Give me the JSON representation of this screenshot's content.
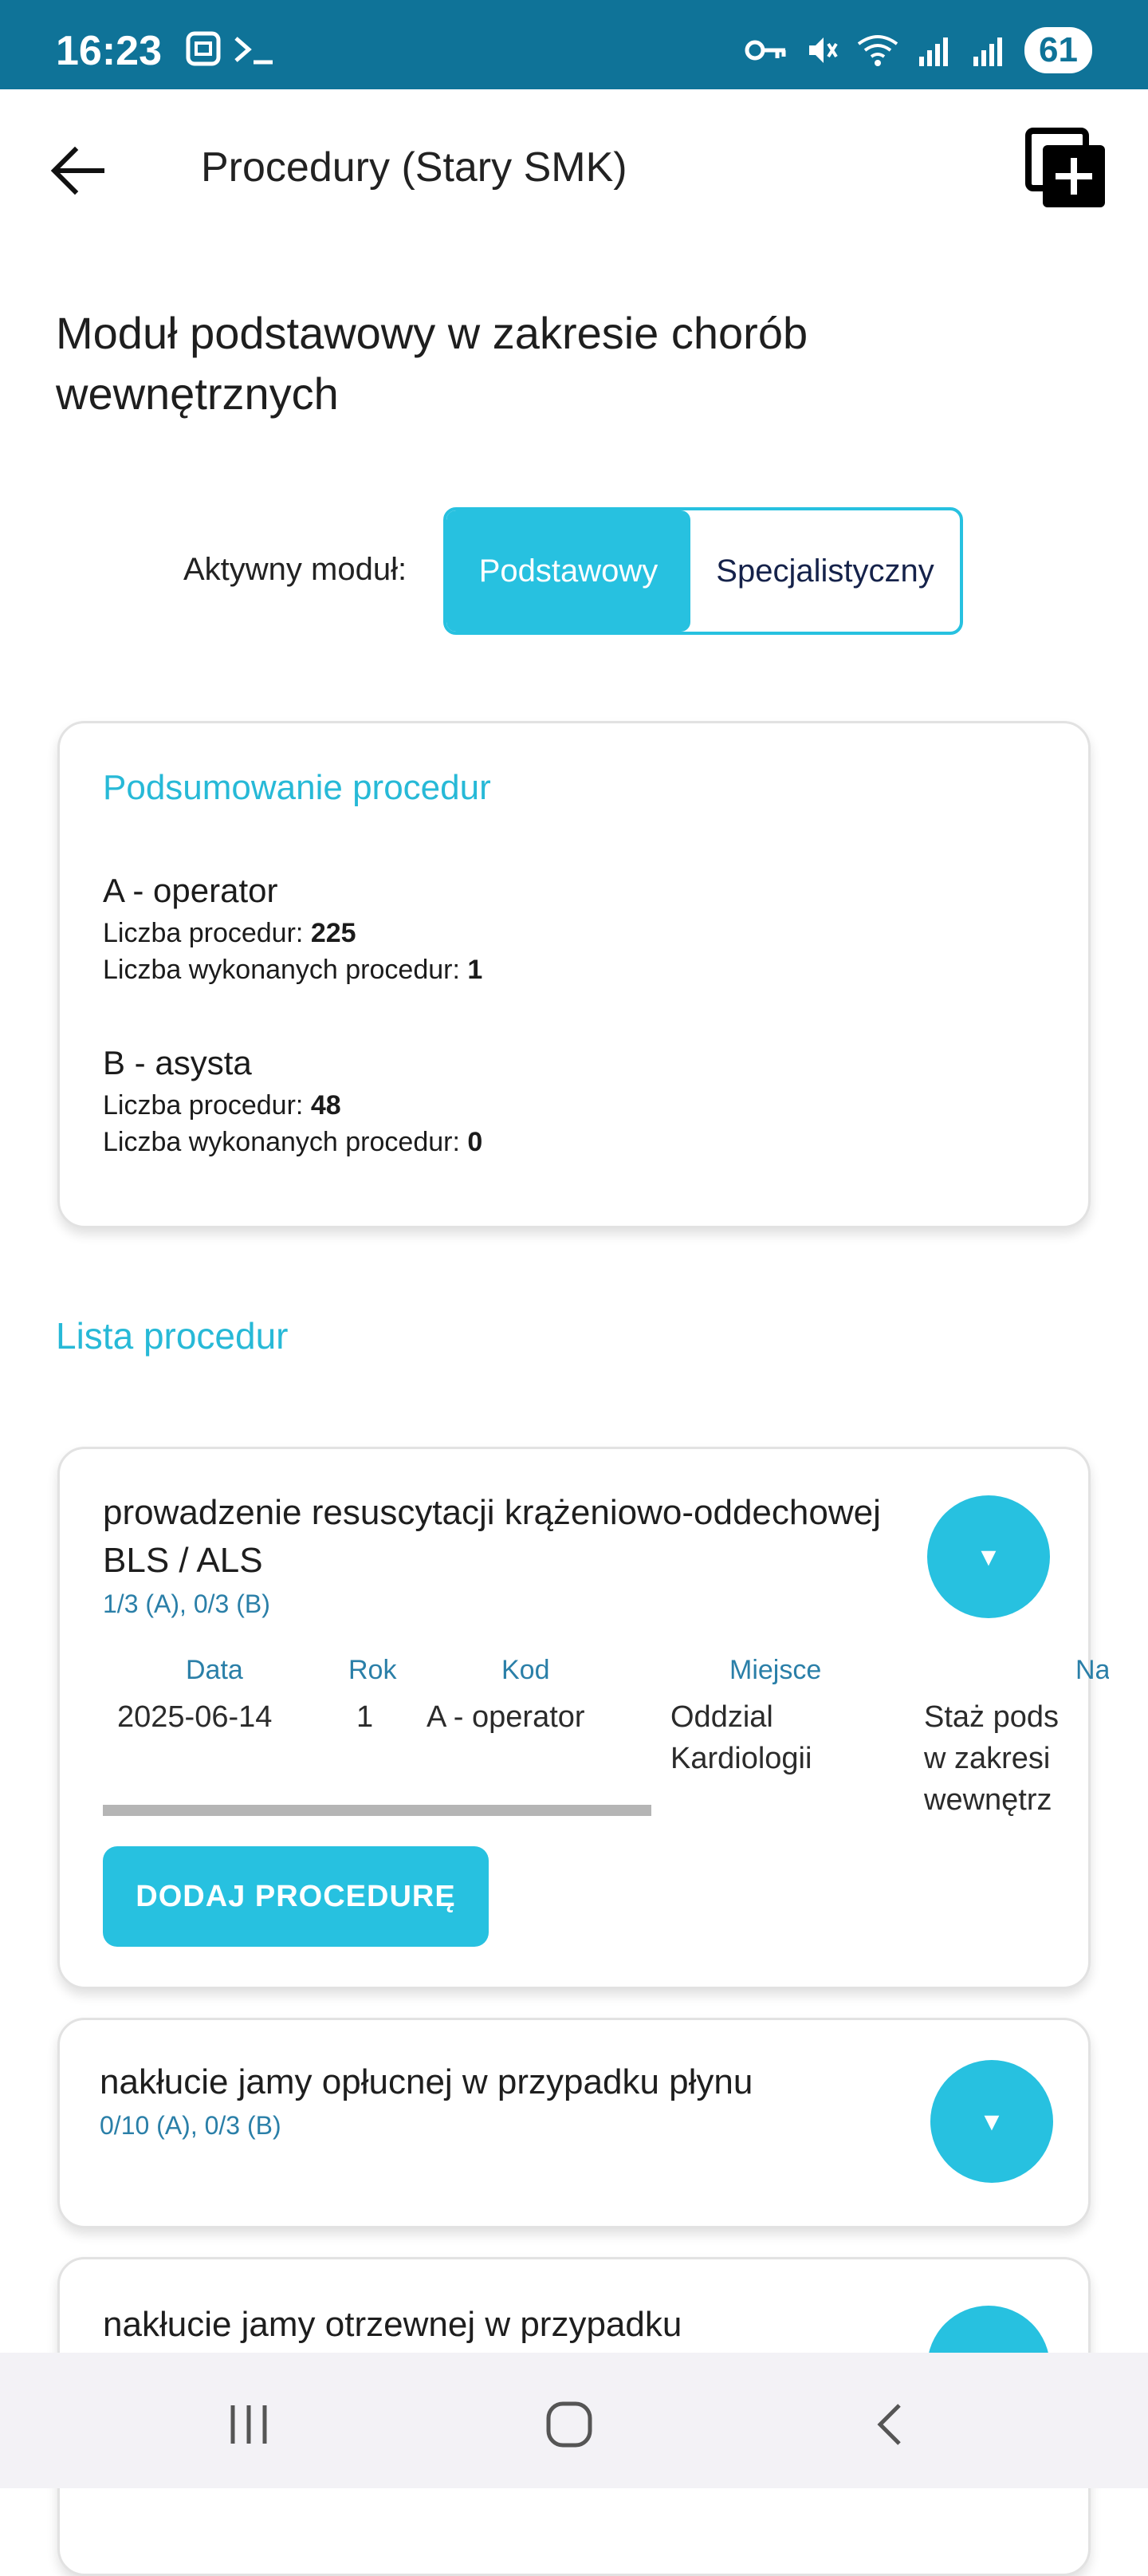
{
  "status_bar": {
    "time": "16:23",
    "battery": "61"
  },
  "app_bar": {
    "title": "Procedury (Stary SMK)"
  },
  "module": {
    "title": "Moduł podstawowy w zakresie chorób wewnętrznych",
    "active_label": "Aktywny moduł:",
    "toggle": {
      "basic": "Podstawowy",
      "specialist": "Specjalistyczny",
      "selected": "Podstawowy"
    }
  },
  "summary": {
    "title": "Podsumowanie procedur",
    "groups": [
      {
        "name": "A - operator",
        "count_label": "Liczba procedur: ",
        "count": "225",
        "done_label": "Liczba wykonanych procedur: ",
        "done": "1"
      },
      {
        "name": "B - asysta",
        "count_label": "Liczba procedur: ",
        "count": "48",
        "done_label": "Liczba wykonanych procedur: ",
        "done": "0"
      }
    ]
  },
  "list": {
    "title": "Lista procedur",
    "procedures": [
      {
        "name": "prowadzenie resuscytacji krążeniowo-oddechowej BLS / ALS",
        "progress": "1/3 (A), 0/3 (B)",
        "expand_glyph": "▼",
        "table": {
          "headers": [
            "Data",
            "Rok",
            "Kod",
            "Miejsce",
            "Na"
          ],
          "row": {
            "date": "2025-06-14",
            "year": "1",
            "code": "A - operator",
            "place": "Oddzial Kardiologii",
            "name": "Staż pods w zakresi wewnętrz"
          }
        },
        "add_button": "DODAJ PROCEDURĘ"
      },
      {
        "name": "nakłucie jamy opłucnej w przypadku płynu",
        "progress": "0/10 (A), 0/3 (B)",
        "expand_glyph": "▼"
      },
      {
        "name": "nakłucie jamy otrzewnej w przypadku",
        "progress": "",
        "expand_glyph": "▼"
      }
    ]
  },
  "colors": {
    "status_bar": "#0f7398",
    "accent": "#27c1e0",
    "text_blue": "#2a7fa8"
  }
}
